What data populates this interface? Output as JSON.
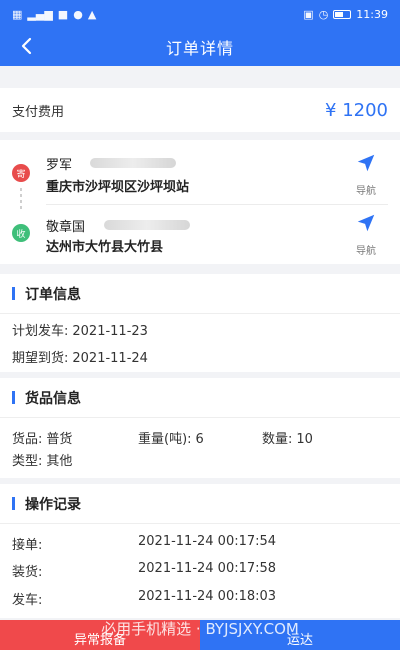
{
  "status_bar": {
    "time": "11:39"
  },
  "header": {
    "title": "订单详情"
  },
  "fee": {
    "label": "支付费用",
    "amount": "¥ 1200"
  },
  "route": {
    "sender": {
      "badge": "寄",
      "name": "罗军",
      "address": "重庆市沙坪坝区沙坪坝站",
      "nav_label": "导航"
    },
    "receiver": {
      "badge": "收",
      "name": "敬章国",
      "address": "达州市大竹县大竹县",
      "nav_label": "导航"
    }
  },
  "order_info": {
    "title": "订单信息",
    "plan_depart_label": "计划发车:",
    "plan_depart_value": "2021-11-23",
    "expect_arrive_label": "期望到货:",
    "expect_arrive_value": "2021-11-24"
  },
  "goods_info": {
    "title": "货品信息",
    "goods_label": "货品:",
    "goods_value": "普货",
    "weight_label": "重量(吨):",
    "weight_value": "6",
    "qty_label": "数量:",
    "qty_value": "10",
    "type_label": "类型:",
    "type_value": "其他"
  },
  "operation_log": {
    "title": "操作记录",
    "entries": [
      {
        "label": "接单:",
        "time": "2021-11-24 00:17:54"
      },
      {
        "label": "装货:",
        "time": "2021-11-24 00:17:58"
      },
      {
        "label": "发车:",
        "time": "2021-11-24 00:18:03"
      }
    ]
  },
  "actions": {
    "abnormal_label": "异常报备",
    "arrive_label": "运达"
  },
  "watermark": "必用手机精选 · BYJSJXY.COM",
  "colors": {
    "primary": "#2f73f4",
    "danger": "#f0494b",
    "sender_badge": "#e84c4c",
    "receiver_badge": "#3fbf7a"
  }
}
